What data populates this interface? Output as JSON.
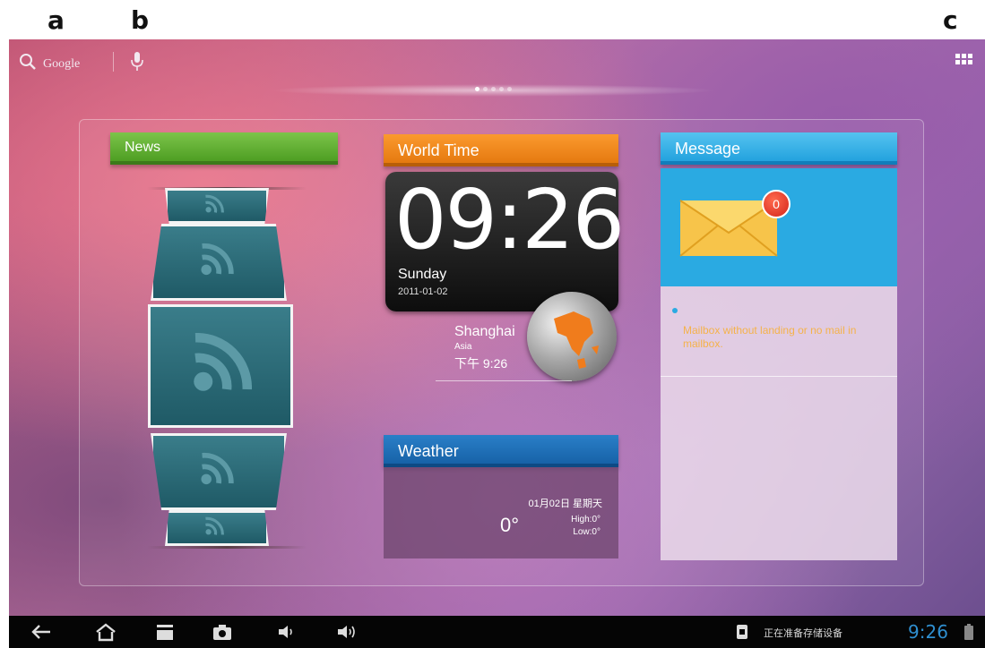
{
  "figure_labels": {
    "a": "a",
    "b": "b",
    "c": "c"
  },
  "topbar": {
    "search_label": "Google",
    "search_icon": "search-icon",
    "voice_icon": "microphone-icon",
    "apps_icon": "app-grid-icon"
  },
  "pager": {
    "count": 5,
    "active_index": 0
  },
  "widgets": {
    "news": {
      "title": "News",
      "color": "#4e9e23"
    },
    "world_time": {
      "title": "World Time",
      "color": "#e57a10",
      "time": "09:26",
      "day": "Sunday",
      "date": "2011-01-02",
      "city": "Shanghai",
      "region": "Asia",
      "local_time": "下午 9:26"
    },
    "weather": {
      "title": "Weather",
      "color": "#1762a8",
      "date": "01月02日  星期天",
      "temp": "0°",
      "high": "High:0°",
      "low": "Low:0°"
    },
    "message": {
      "title": "Message",
      "color": "#23a2de",
      "unread_count": "0",
      "empty_text": "Mailbox without landing or no mail in mailbox."
    }
  },
  "navbar": {
    "icons": [
      "back-icon",
      "home-icon",
      "recent-apps-icon",
      "camera-icon",
      "volume-down-icon",
      "volume-up-icon"
    ],
    "status_text": "正在准备存储设备",
    "clock": "9:26"
  }
}
